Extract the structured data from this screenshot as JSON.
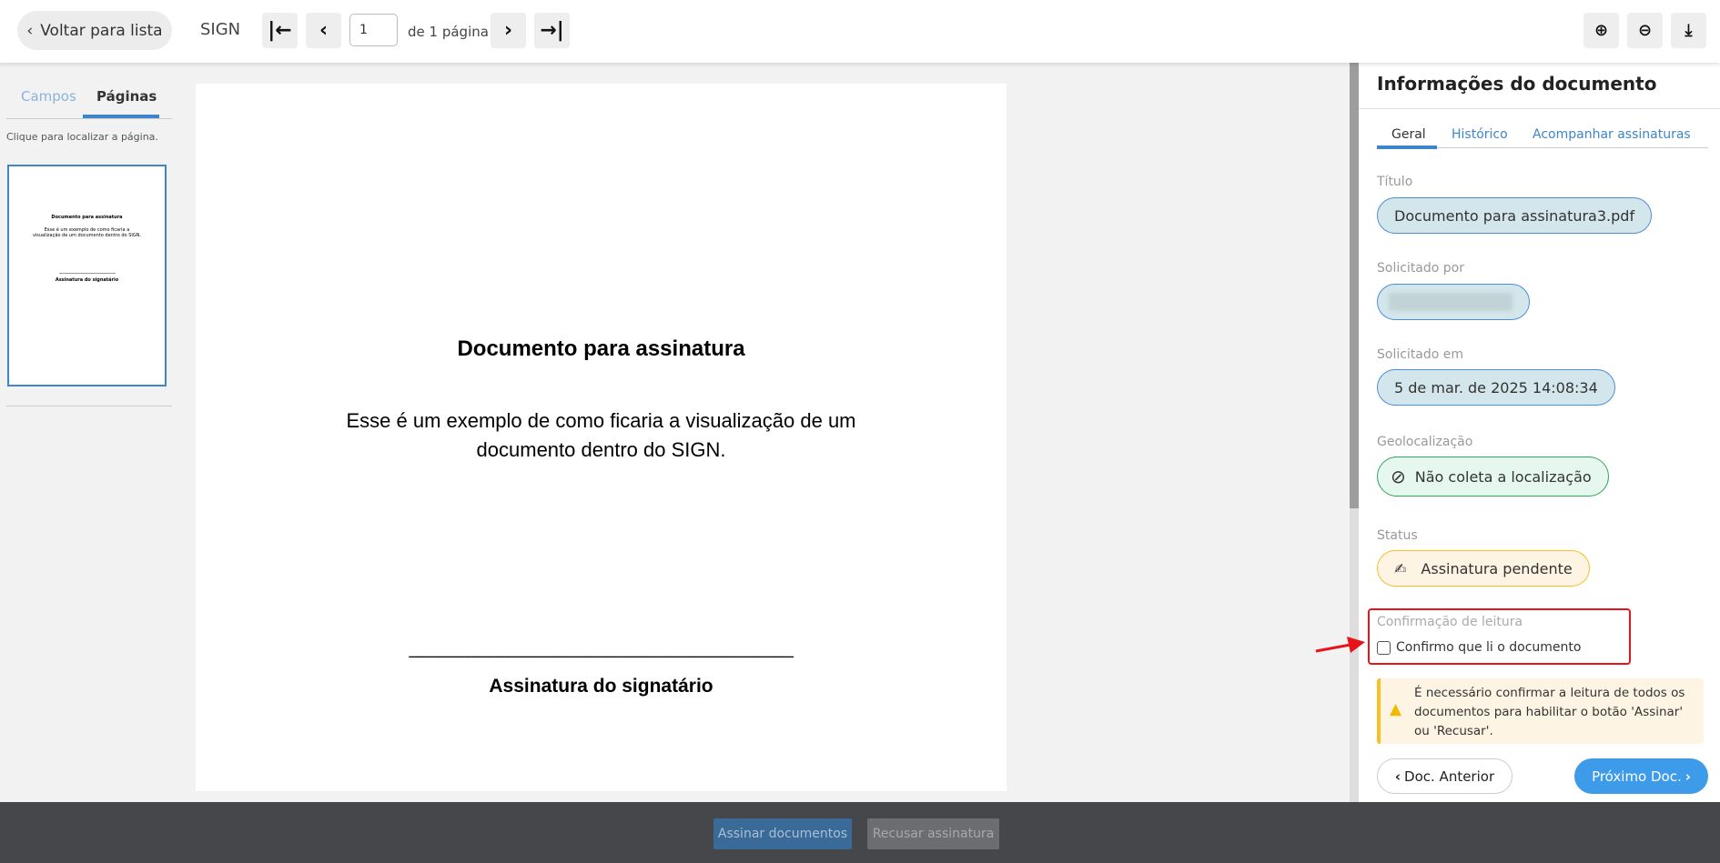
{
  "header": {
    "back_label": "Voltar para lista",
    "app_name": "SIGN",
    "page_value": "1",
    "page_total": "de 1 página",
    "icons": [
      "first-page-icon",
      "prev-page-icon",
      "next-page-icon",
      "last-page-icon",
      "zoom-in-icon",
      "zoom-out-icon",
      "download-icon"
    ]
  },
  "sidebar": {
    "tabs": [
      "Campos",
      "Páginas"
    ],
    "hint": "Clique para localizar a página."
  },
  "document": {
    "title": "Documento para assinatura",
    "body_line1": "Esse é um exemplo de como ficaria a visualização de um",
    "body_line2": "documento dentro do SIGN.",
    "signature_line": "_______________________________________",
    "signature_label": "Assinatura do signatário"
  },
  "panel": {
    "title": "Informações do documento",
    "tabs": [
      "Geral",
      "Histórico",
      "Acompanhar assinaturas"
    ],
    "fields": {
      "titulo_label": "Título",
      "titulo_value": "Documento para assinatura3.pdf",
      "solicitado_por_label": "Solicitado por",
      "solicitado_em_label": "Solicitado em",
      "solicitado_em_value": "5 de mar. de 2025 14:08:34",
      "geo_label": "Geolocalização",
      "geo_value": "Não coleta a localização",
      "status_label": "Status",
      "status_value": "Assinatura pendente"
    },
    "confirm_label": "Confirmação de leitura",
    "confirm_checkbox": "Confirmo que li o documento",
    "warning": "É necessário confirmar a leitura de todos os documentos para habilitar o botão 'Assinar' ou 'Recusar'.",
    "prev_doc": "Doc. Anterior",
    "next_doc": "Próximo Doc."
  },
  "footer": {
    "sign_button": "Assinar documentos",
    "refuse_button": "Recusar assinatura"
  },
  "colors": {
    "accent": "#3d9be9",
    "highlight": "#e8141c",
    "warning": "#fbbf24",
    "footer": "#46474b"
  }
}
